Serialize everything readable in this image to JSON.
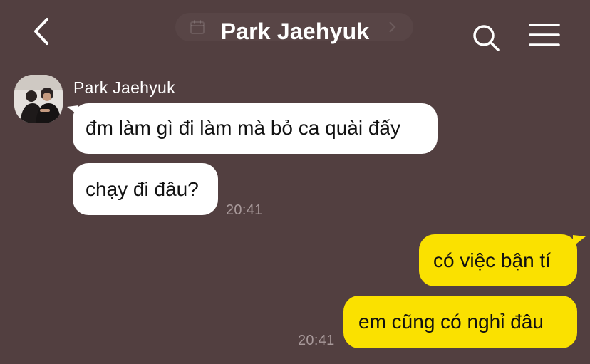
{
  "header": {
    "title": "Park Jaehyuk",
    "back_icon": "chevron-left-icon",
    "search_icon": "search-icon",
    "menu_icon": "hamburger-menu-icon",
    "date_pill_icon": "calendar-icon"
  },
  "messages": [
    {
      "sender": "Park Jaehyuk",
      "direction": "incoming",
      "text": "đm làm gì đi làm mà bỏ ca quài đấy"
    },
    {
      "sender": "Park Jaehyuk",
      "direction": "incoming",
      "text": "chạy đi đâu?",
      "time": "20:41"
    },
    {
      "direction": "outgoing",
      "text": "có việc bận tí"
    },
    {
      "direction": "outgoing",
      "text": "em cũng có nghỉ đâu",
      "time": "20:41"
    }
  ],
  "colors": {
    "background": "#523f40",
    "incoming_bubble": "#ffffff",
    "outgoing_bubble": "#fae100",
    "timestamp": "#a8999a"
  }
}
